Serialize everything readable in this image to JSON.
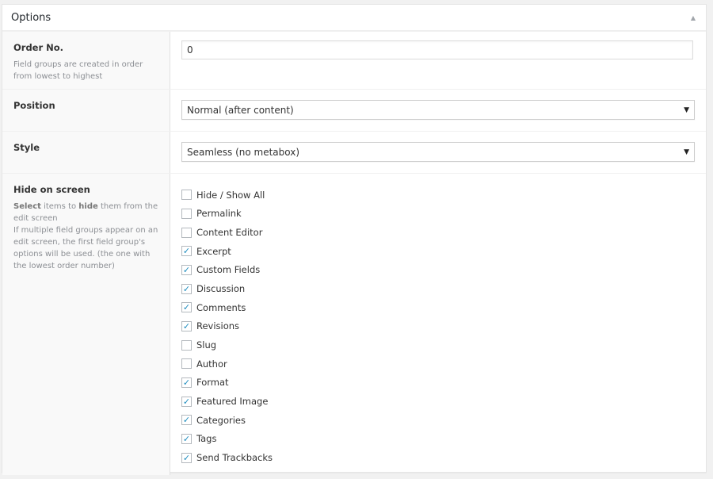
{
  "header": {
    "title": "Options",
    "toggle_icon": "▲"
  },
  "order": {
    "label": "Order No.",
    "description": "Field groups are created in order from lowest to highest",
    "value": "0"
  },
  "position": {
    "label": "Position",
    "selected": "Normal (after content)"
  },
  "style": {
    "label": "Style",
    "selected": "Seamless (no metabox)"
  },
  "hide": {
    "label": "Hide on screen",
    "desc_select": "Select",
    "desc_mid": " items to ",
    "desc_hide": "hide",
    "desc_end": " them from the edit screen",
    "desc_note": "If multiple field groups appear on an edit screen, the first field group's options will be used. (the one with the lowest order number)",
    "items": [
      {
        "label": "Hide / Show All",
        "checked": false
      },
      {
        "label": "Permalink",
        "checked": false
      },
      {
        "label": "Content Editor",
        "checked": false
      },
      {
        "label": "Excerpt",
        "checked": true
      },
      {
        "label": "Custom Fields",
        "checked": true
      },
      {
        "label": "Discussion",
        "checked": true
      },
      {
        "label": "Comments",
        "checked": true
      },
      {
        "label": "Revisions",
        "checked": true
      },
      {
        "label": "Slug",
        "checked": false
      },
      {
        "label": "Author",
        "checked": false
      },
      {
        "label": "Format",
        "checked": true
      },
      {
        "label": "Featured Image",
        "checked": true
      },
      {
        "label": "Categories",
        "checked": true
      },
      {
        "label": "Tags",
        "checked": true
      },
      {
        "label": "Send Trackbacks",
        "checked": true
      }
    ]
  },
  "colors": {
    "check": "#1e8cbe"
  }
}
